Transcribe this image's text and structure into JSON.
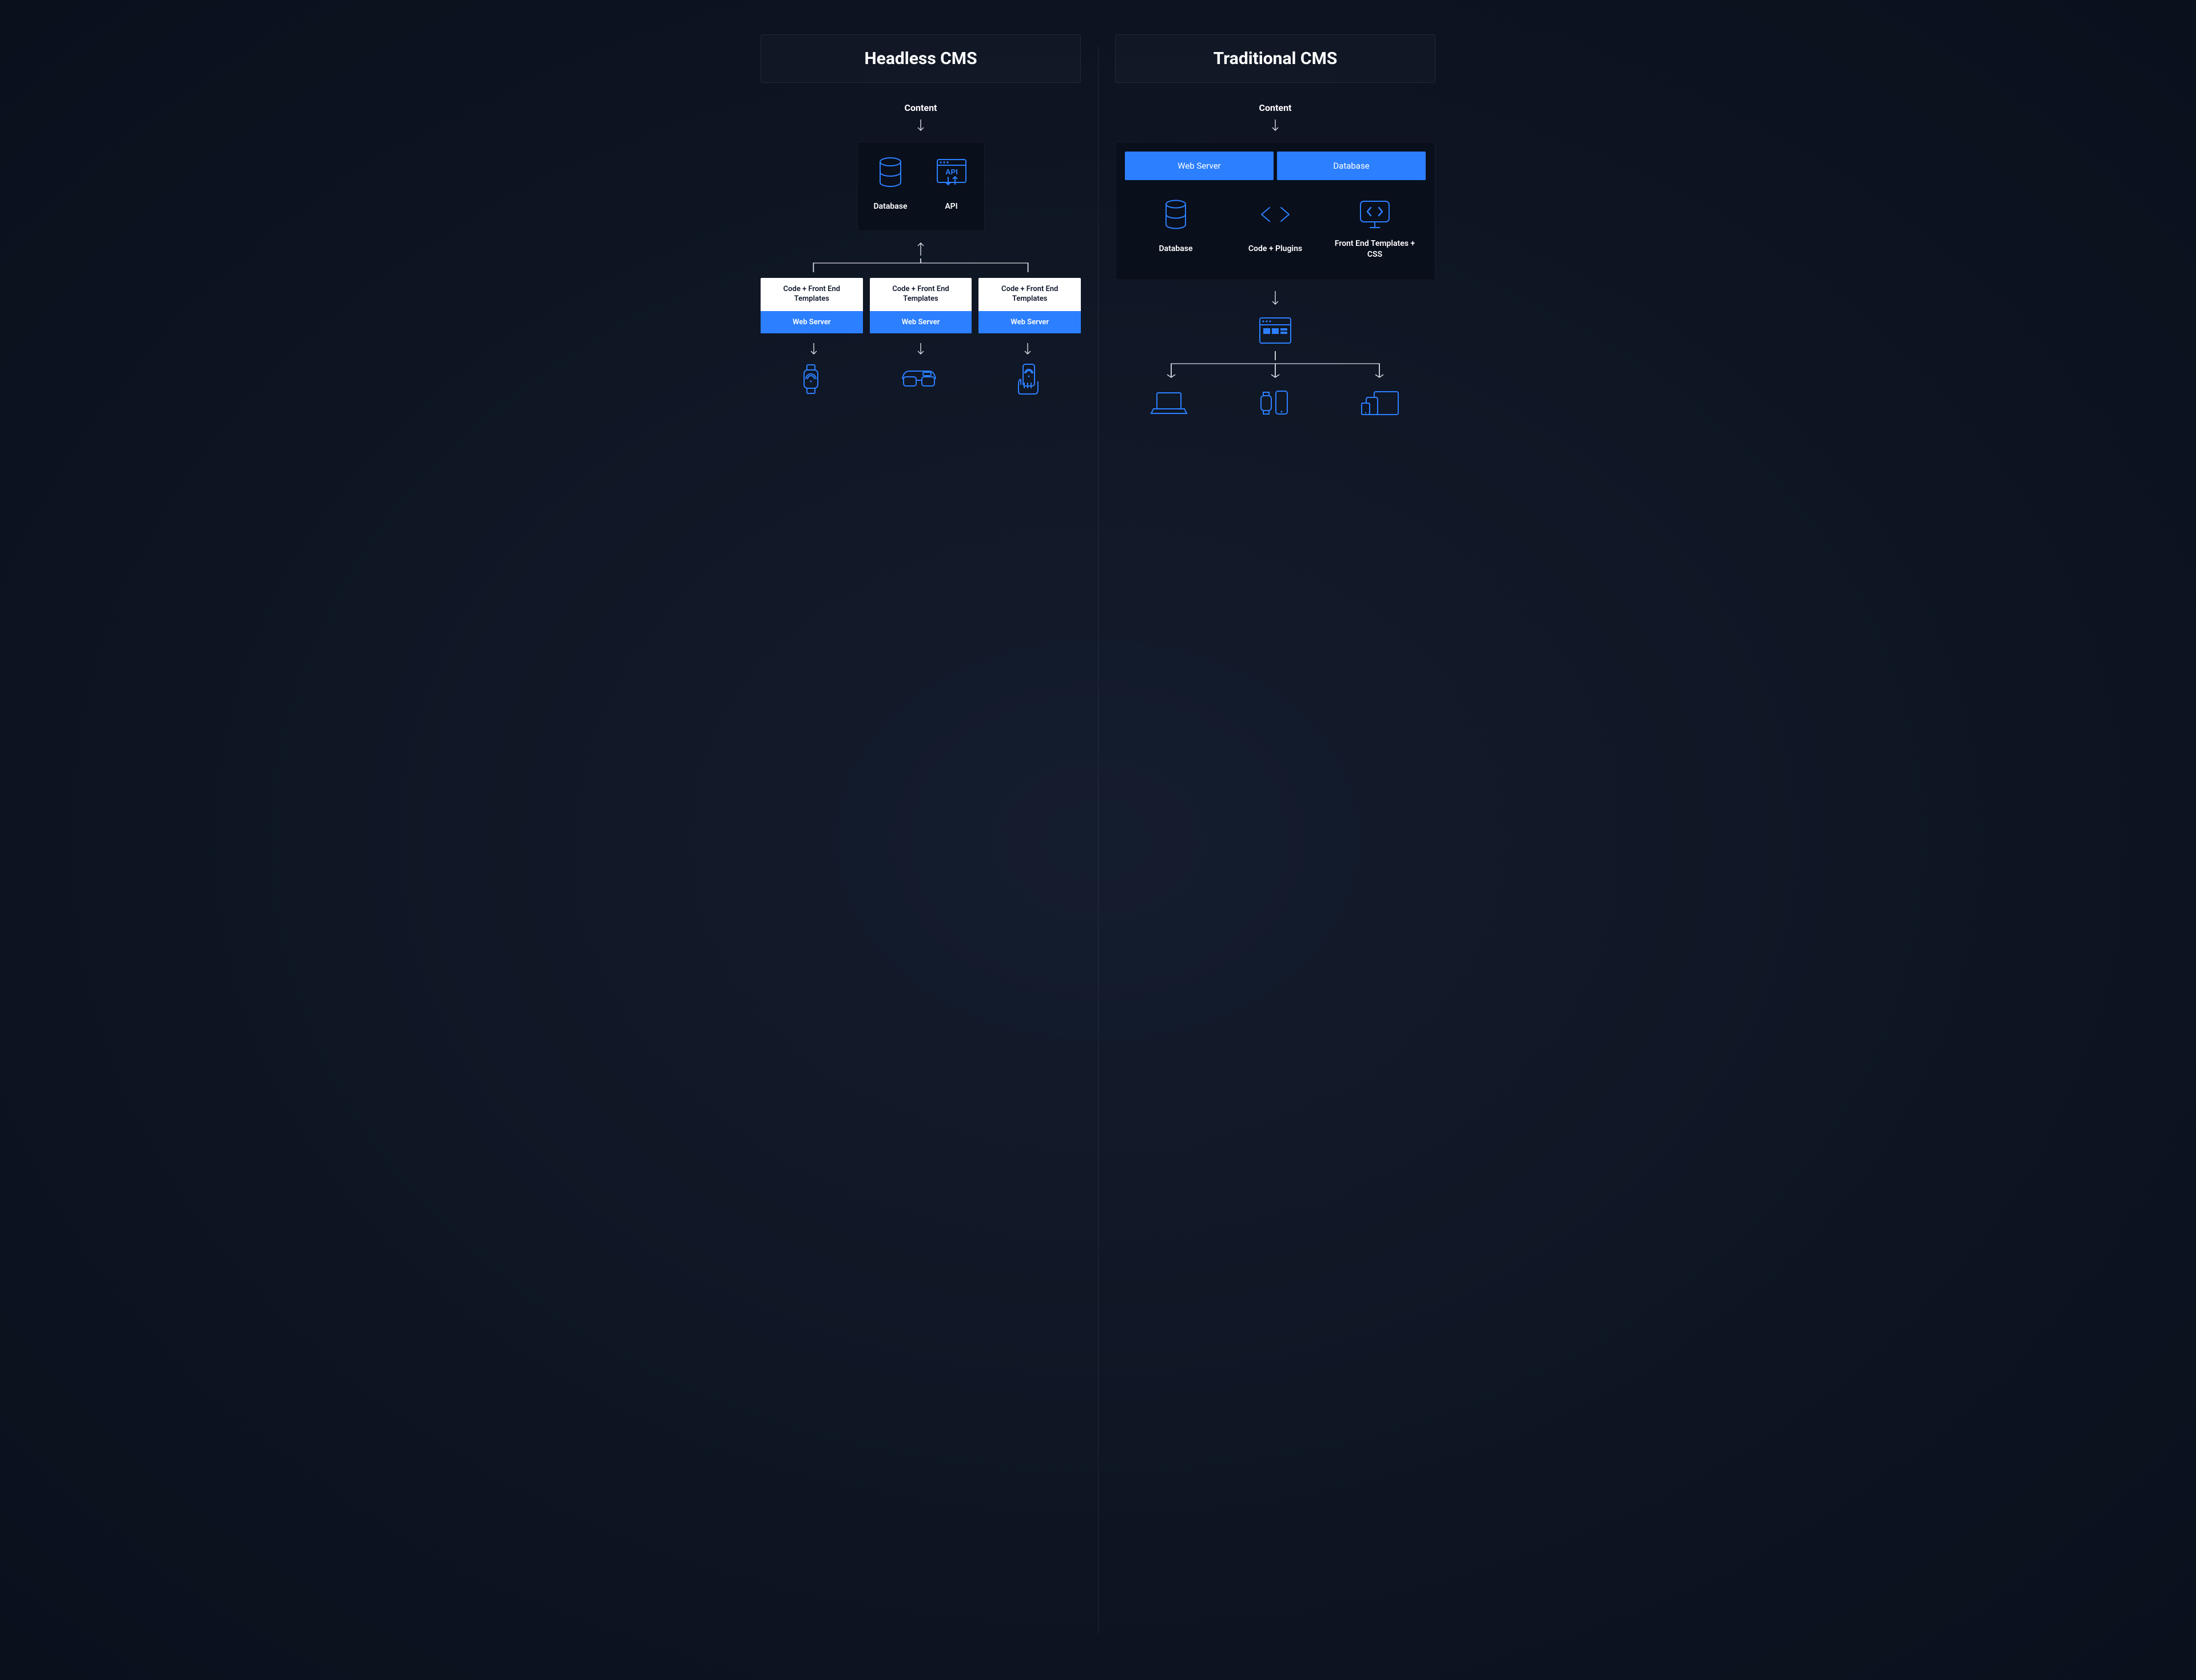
{
  "left": {
    "title": "Headless CMS",
    "content_label": "Content",
    "panel": {
      "items": [
        {
          "label": "Database"
        },
        {
          "label": "API"
        }
      ]
    },
    "cards": [
      {
        "top": "Code + Front End Templates",
        "bottom": "Web Server"
      },
      {
        "top": "Code + Front End Templates",
        "bottom": "Web Server"
      },
      {
        "top": "Code + Front End Templates",
        "bottom": "Web Server"
      }
    ]
  },
  "right": {
    "title": "Traditional CMS",
    "content_label": "Content",
    "tabs": [
      {
        "label": "Web Server"
      },
      {
        "label": "Database"
      }
    ],
    "items": [
      {
        "label": "Database"
      },
      {
        "label": "Code + Plugins"
      },
      {
        "label": "Front End Templates + CSS"
      }
    ]
  },
  "colors": {
    "accent": "#2c7fff",
    "panel": "#0a0f1c",
    "bg": "#0e1626"
  }
}
